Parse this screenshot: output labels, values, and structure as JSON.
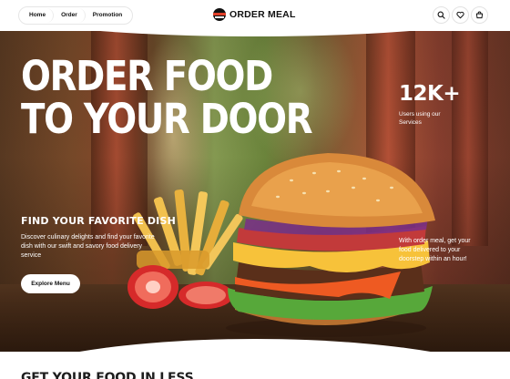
{
  "header": {
    "nav": [
      "Home",
      "Order",
      "Promotion"
    ],
    "brand": "ORDER MEAL",
    "icons": [
      "search-icon",
      "heart-icon",
      "cart-icon"
    ]
  },
  "hero": {
    "title_line1": "ORDER FOOD",
    "title_line2": "TO YOUR DOOR",
    "stat_number": "12K+",
    "stat_label": "Users using our Services",
    "sub_heading": "FIND YOUR FAVORITE DISH",
    "sub_text": "Discover culinary delights and find your favorite dish with our swift and savory food delivery service",
    "explore_button": "Explore Menu",
    "side_note": "With order meal, get your food delivered to your doorstep within an hour!"
  },
  "section": {
    "heading": "GET YOUR FOOD IN LESS"
  },
  "colors": {
    "accent": "#e2402a",
    "text_dark": "#1d1d1d",
    "white": "#ffffff"
  }
}
